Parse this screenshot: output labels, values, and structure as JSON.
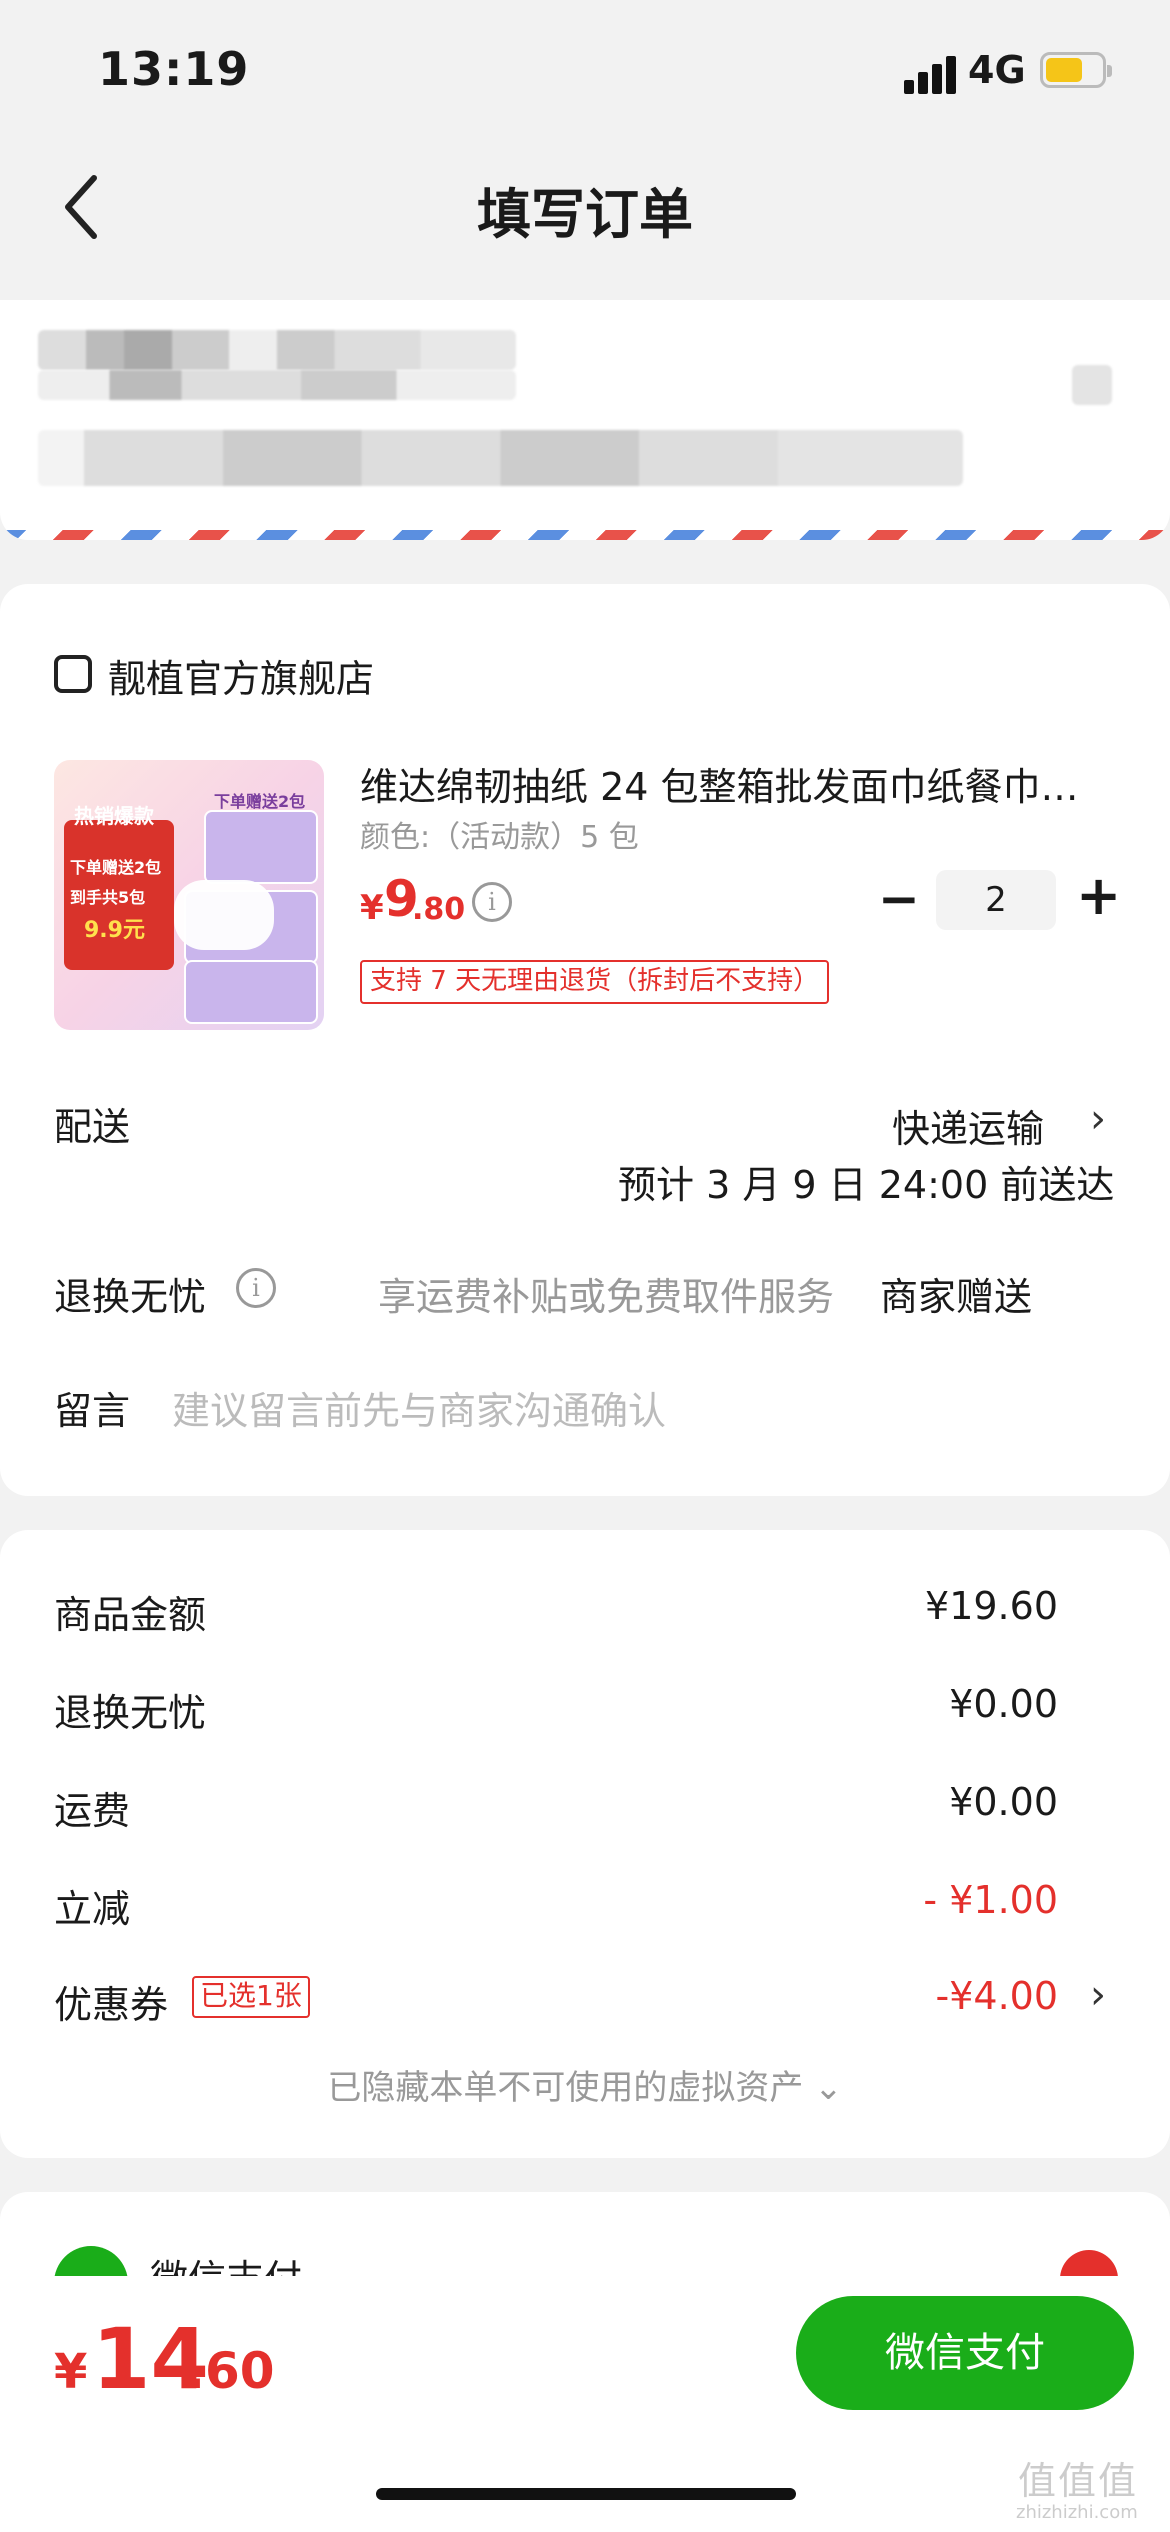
{
  "status_bar": {
    "time": "13:19",
    "network": "4G"
  },
  "header": {
    "title": "填写订单"
  },
  "store": {
    "name": "靓植官方旗舰店"
  },
  "product": {
    "title": "维达绵韧抽纸 24 包整箱批发面巾纸餐巾…",
    "spec": "颜色:（活动款）5 包",
    "currency": "¥",
    "price_int": "9",
    "price_dec": ".80",
    "quantity": "2",
    "return_policy": "支持 7 天无理由退货（拆封后不支持）",
    "thumb_texts": [
      "热销爆款",
      "下单赠送2包",
      "到手共5包",
      "9.9元",
      "下单赠送2包"
    ]
  },
  "delivery": {
    "label": "配送",
    "method": "快递运输",
    "eta": "预计 3 月 9 日 24:00 前送达"
  },
  "return_worry": {
    "label": "退换无忧",
    "desc": "享运费补贴或免费取件服务",
    "value": "商家赠送"
  },
  "message": {
    "label": "留言",
    "placeholder": "建议留言前先与商家沟通确认"
  },
  "summary": {
    "rows": [
      {
        "label": "商品金额",
        "value": "¥19.60"
      },
      {
        "label": "退换无忧",
        "value": "¥0.00"
      },
      {
        "label": "运费",
        "value": "¥0.00"
      },
      {
        "label": "立减",
        "value": "- ¥1.00"
      },
      {
        "label": "优惠券",
        "value": "-¥4.00",
        "tag": "已选1张"
      }
    ],
    "hidden_assets": "已隐藏本单不可使用的虚拟资产 ⌄"
  },
  "payment": {
    "method": "微信支付"
  },
  "bottom_bar": {
    "currency": "¥",
    "total_int": "14",
    "total_dec": ".60",
    "pay_button": "微信支付"
  },
  "watermark": {
    "logo": "值值值",
    "domain": "zhizhizhi.com"
  },
  "colors": {
    "accent_red": "#e4302c",
    "wechat_green": "#1aad19"
  }
}
